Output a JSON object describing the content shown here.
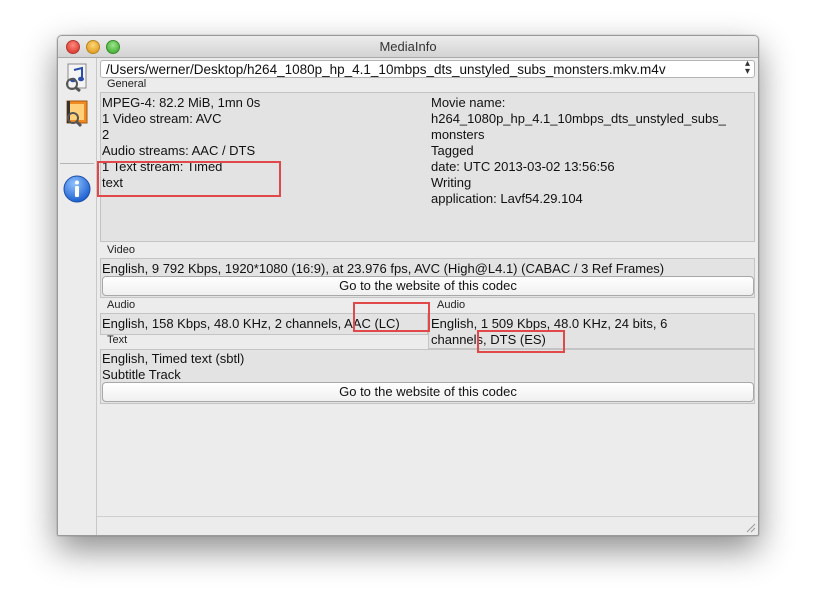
{
  "window": {
    "title": "MediaInfo"
  },
  "file_selector": {
    "value": "/Users/werner/Desktop/h264_1080p_hp_4.1_10mbps_dts_unstyled_subs_monsters.mkv.m4v",
    "stepper": "▴▾"
  },
  "general": {
    "label": "General",
    "left_lines": [
      "MPEG-4: 82.2 MiB, 1mn 0s",
      "1 Video stream: AVC",
      "2",
      "Audio streams: AAC / DTS",
      "1 Text stream: Timed",
      "text"
    ],
    "right_lines": [
      "Movie name:",
      "h264_1080p_hp_4.1_10mbps_dts_unstyled_subs_",
      "monsters",
      "Tagged",
      "date: UTC 2013-03-02 13:56:56",
      "Writing",
      "application: Lavf54.29.104"
    ]
  },
  "video": {
    "label": "Video",
    "line": "English, 9 792 Kbps, 1920*1080 (16:9), at 23.976 fps, AVC (High@L4.1) (CABAC / 3 Ref Frames)",
    "button": "Go to the website of this codec"
  },
  "audio1": {
    "label": "Audio",
    "line": "English, 158 Kbps, 48.0 KHz, 2 channels, AAC (LC)"
  },
  "audio2": {
    "label": "Audio",
    "lines": [
      "English, 1 509 Kbps, 48.0 KHz, 24 bits, 6",
      "channels, DTS (ES)"
    ]
  },
  "text": {
    "label": "Text",
    "lines": [
      "English, Timed text (sbtl)",
      "Subtitle Track"
    ],
    "button": "Go to the website of this codec"
  },
  "toolbar": {
    "icons": [
      "music-file-icon",
      "movie-file-icon",
      "info-icon"
    ]
  },
  "colors": {
    "highlight": "#e0484a",
    "window_bg": "#ececec",
    "panel_bg": "#e3e3e3"
  }
}
